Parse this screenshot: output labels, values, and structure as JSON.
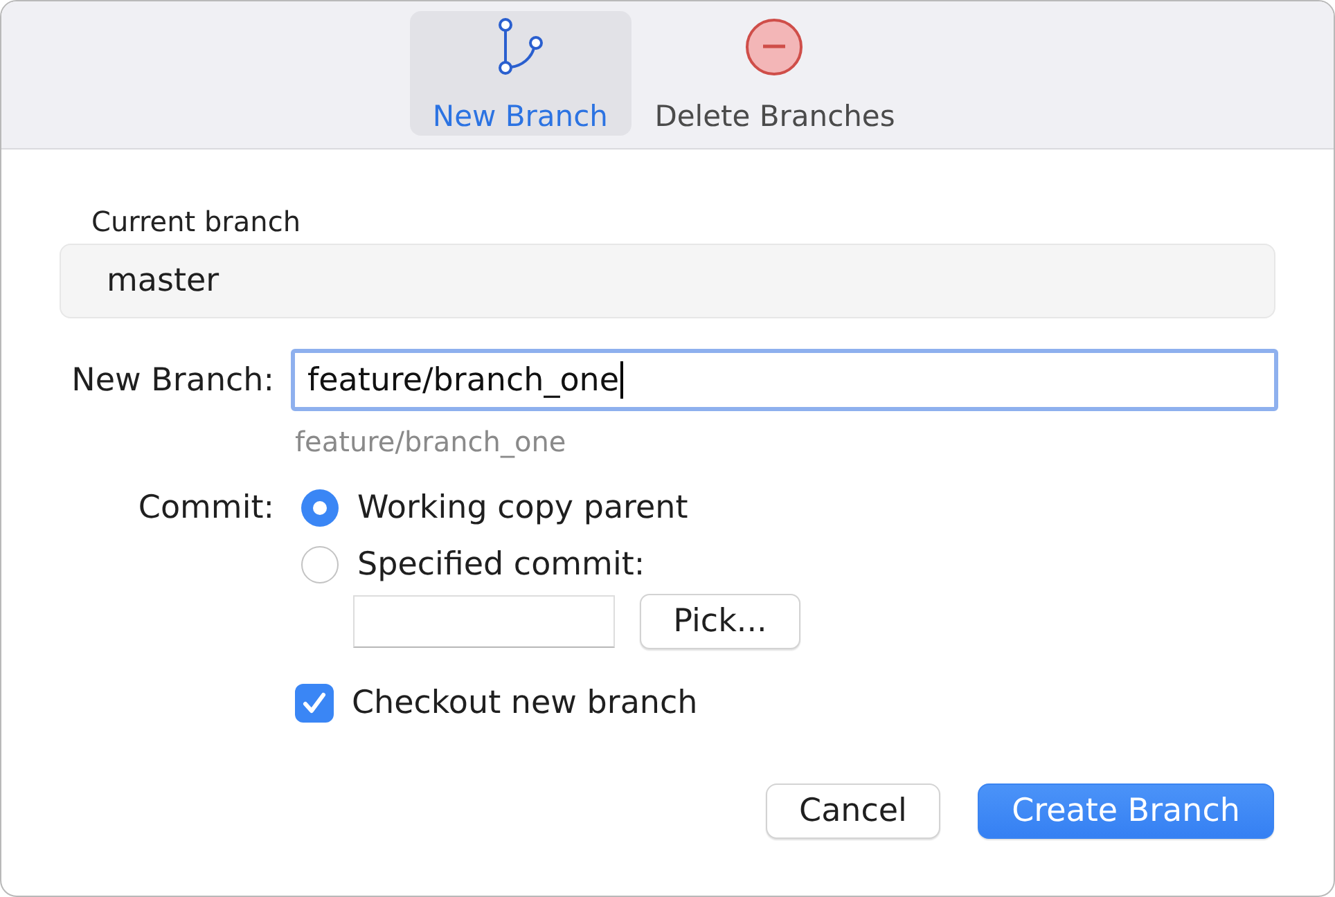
{
  "toolbar": {
    "tabs": [
      {
        "kind": "branch",
        "label": "New Branch",
        "selected": true
      },
      {
        "kind": "delete",
        "label": "Delete Branches",
        "selected": false
      }
    ]
  },
  "current_branch": {
    "label": "Current branch",
    "value": "master"
  },
  "new_branch": {
    "label": "New Branch:",
    "value": "feature/branch_one",
    "focused": true,
    "preview": "feature/branch_one"
  },
  "commit": {
    "label": "Commit:",
    "options": [
      {
        "label": "Working copy parent",
        "selected": true
      },
      {
        "label": "Specified commit:",
        "selected": false
      }
    ],
    "pick_button": "Pick..."
  },
  "checkout": {
    "label": "Checkout new branch",
    "checked": true
  },
  "buttons": [
    {
      "kind": "secondary",
      "label": "Cancel"
    },
    {
      "kind": "primary",
      "label": "Create Branch"
    }
  ]
}
